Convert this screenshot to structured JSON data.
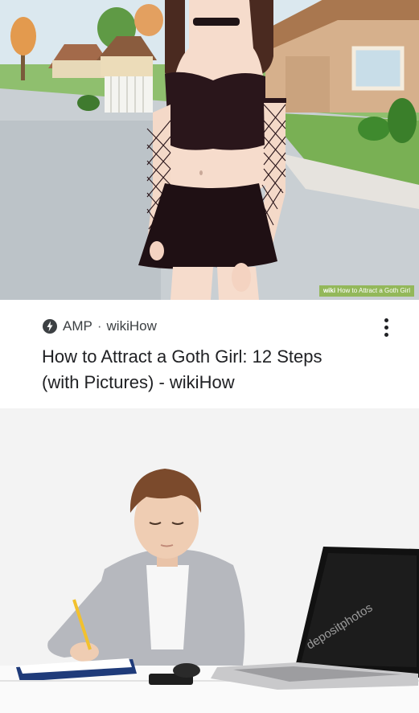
{
  "search_result": {
    "source_amp": "AMP",
    "source_separator": "·",
    "source_site": "wikiHow",
    "title": "How to Attract a Goth Girl: 12 Steps (with Pictures) - wikiHow",
    "menu_icon": "more-vert-icon",
    "amp_icon": "lightning-bolt-icon"
  },
  "illustration": {
    "watermark_brand": "wiki",
    "watermark_text": "How to Attract a Goth Girl"
  },
  "stock_photo": {
    "watermark": "depositphotos"
  },
  "colors": {
    "title": "#202124",
    "source": "#3c4043",
    "wikihow_green": "#93b85a"
  }
}
